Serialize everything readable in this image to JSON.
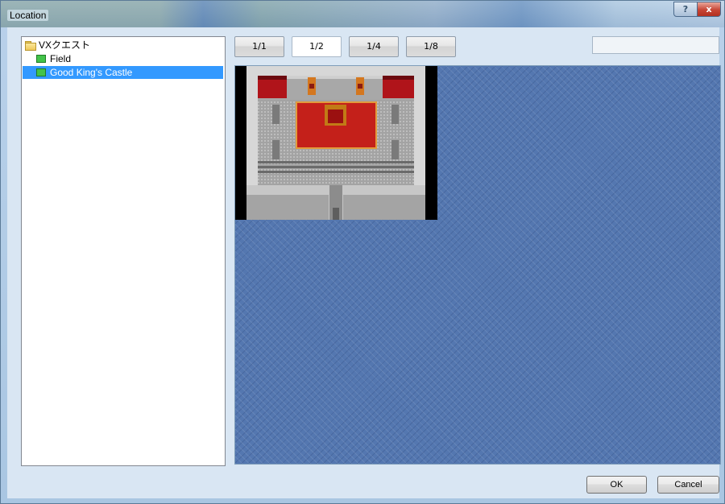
{
  "window": {
    "title": "Location"
  },
  "caption_buttons": {
    "help": "?",
    "close": "x"
  },
  "tree": {
    "root": {
      "label": "VXクエスト",
      "icon": "folder-icon"
    },
    "items": [
      {
        "label": "Field",
        "icon": "map-icon",
        "selected": false
      },
      {
        "label": "Good King's Castle",
        "icon": "map-icon",
        "selected": true
      }
    ]
  },
  "zoom": {
    "options": [
      "1/1",
      "1/2",
      "1/4",
      "1/8"
    ],
    "selected": "1/2"
  },
  "coordinates": {
    "value": ""
  },
  "buttons": {
    "ok": "OK",
    "cancel": "Cancel"
  },
  "colors": {
    "selection": "#3399ff",
    "map_background": "#5477b0",
    "carpet": "#c4201a",
    "curtain": "#b0141a"
  }
}
